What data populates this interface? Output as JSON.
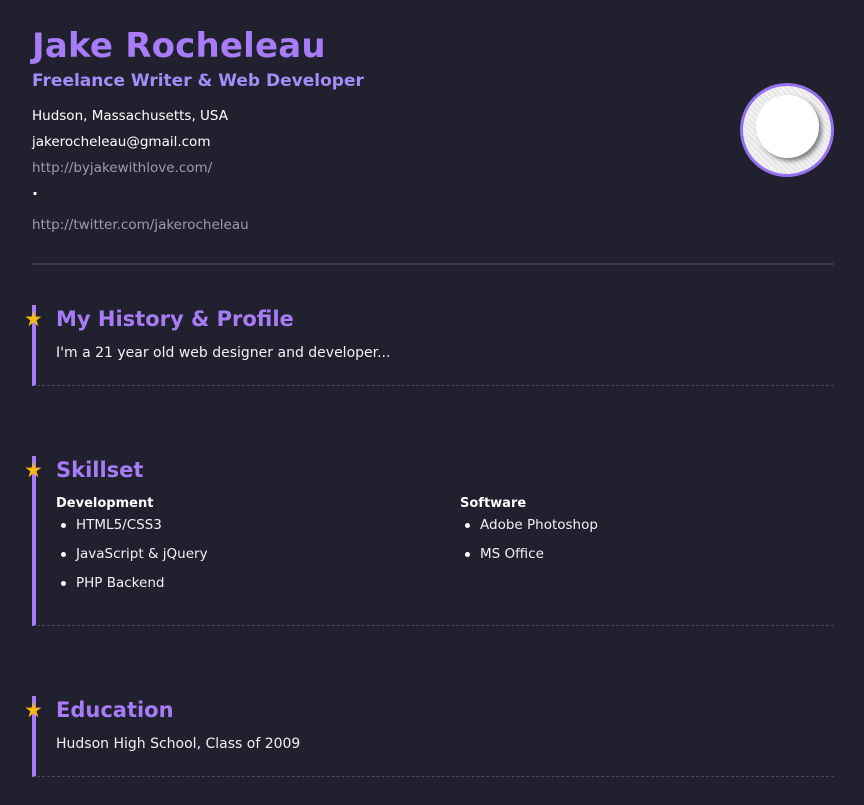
{
  "header": {
    "name": "Jake Rocheleau",
    "tagline": "Freelance Writer & Web Developer",
    "location": "Hudson, Massachusetts, USA",
    "email": "jakerocheleau@gmail.com",
    "website": "http://byjakewithlove.com/",
    "separator": "·",
    "twitter": "http://twitter.com/jakerocheleau"
  },
  "sections": {
    "history": {
      "title": "My History & Profile",
      "text": "I'm a 21 year old web designer and developer..."
    },
    "skills": {
      "title": "Skillset",
      "development": {
        "heading": "Development",
        "items": [
          "HTML5/CSS3",
          "JavaScript & jQuery",
          "PHP Backend"
        ]
      },
      "software": {
        "heading": "Software",
        "items": [
          "Adobe Photoshop",
          "MS Office"
        ]
      }
    },
    "education": {
      "title": "Education",
      "text": "Hudson High School, Class of 2009"
    }
  },
  "icons": {
    "section_marker": "star-icon",
    "avatar": "avatar"
  },
  "colors": {
    "background": "#21202f",
    "accent": "#a77cf6",
    "star": "#f5b916",
    "muted_link": "#9e9cab"
  }
}
